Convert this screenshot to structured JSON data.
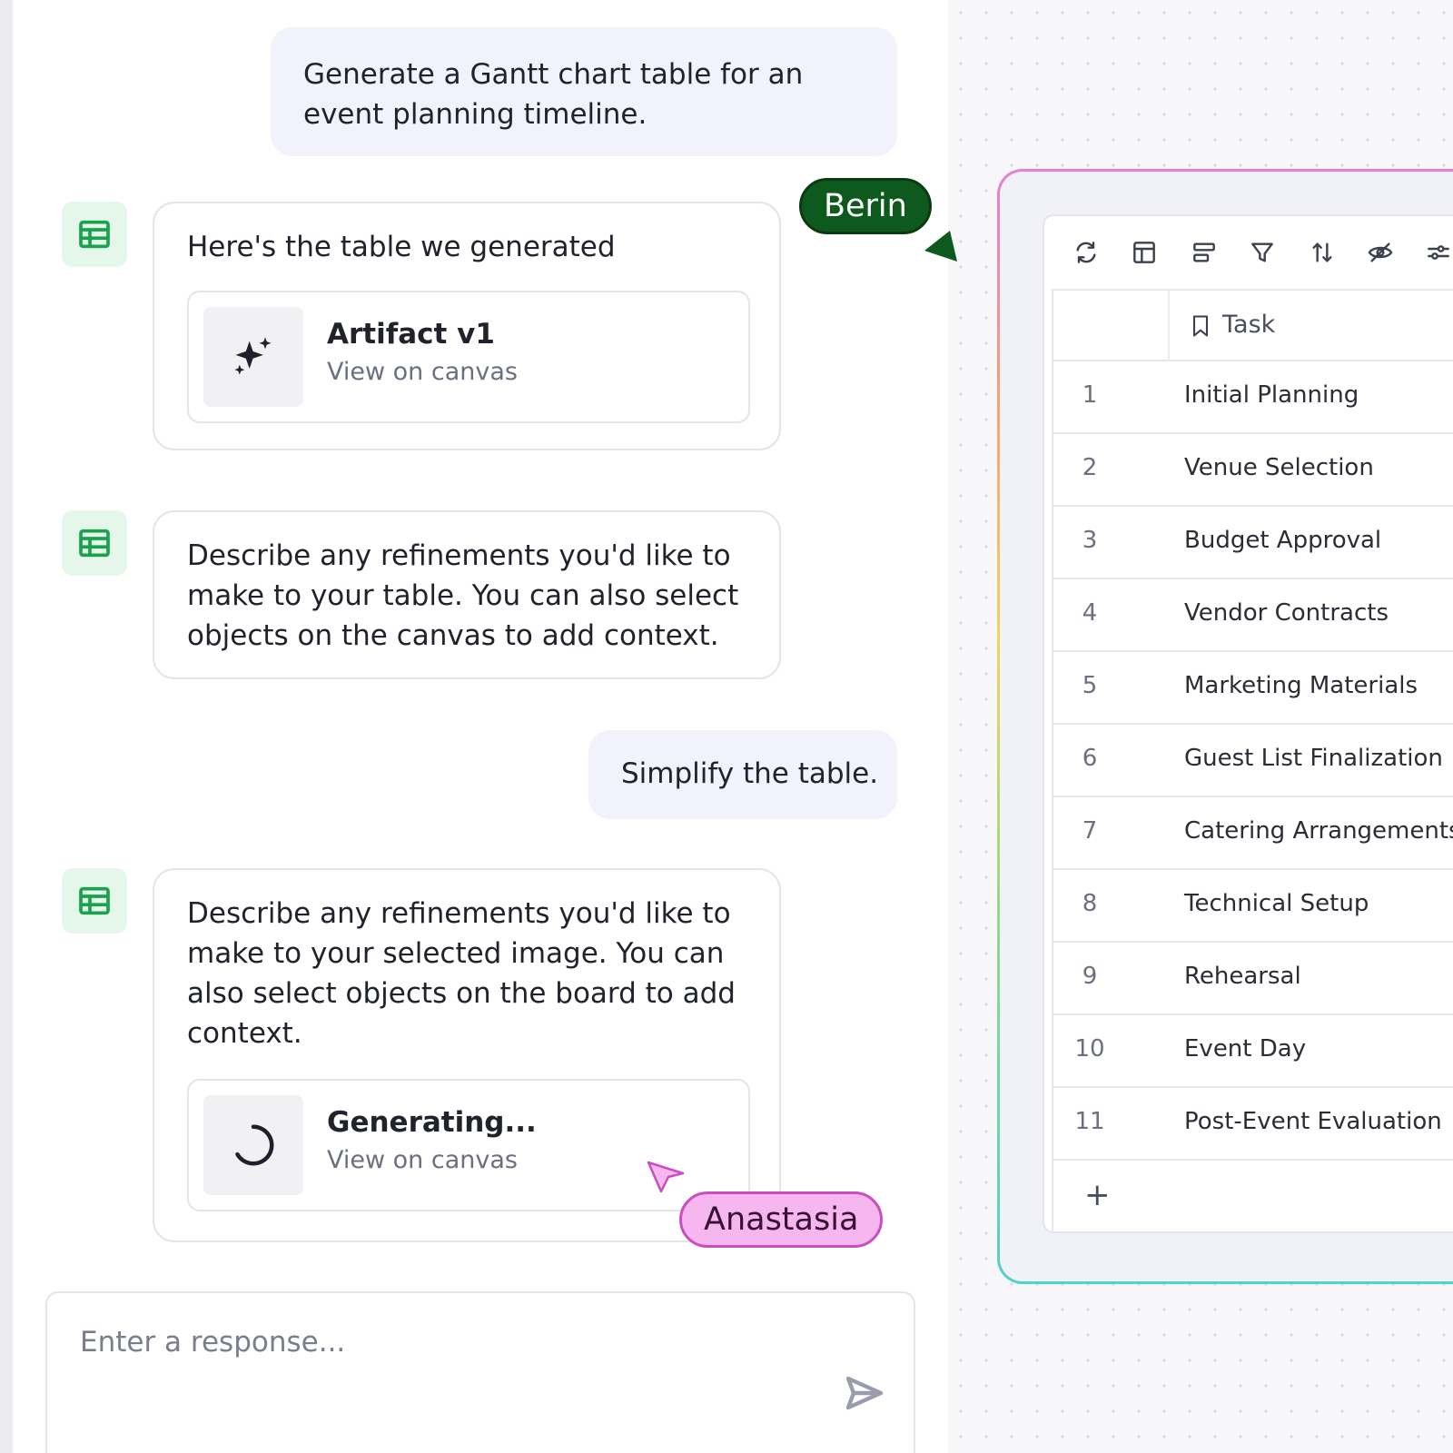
{
  "chat": {
    "messages": [
      {
        "role": "user",
        "text": "Generate a Gantt chart table for an event planning timeline."
      },
      {
        "role": "assistant",
        "text": "Here's the table we generated",
        "artifact": {
          "title": "Artifact v1",
          "link": "View on canvas",
          "icon": "sparkle-icon"
        }
      },
      {
        "role": "assistant",
        "text": "Describe any refinements you'd like to make to your table. You can also select objects on the canvas to add context."
      },
      {
        "role": "user",
        "text": "Simplify the table."
      },
      {
        "role": "assistant",
        "text": "Describe any refinements you'd like to make to your selected image. You can also select objects on the board to add context.",
        "artifact": {
          "title": "Generating...",
          "link": "View on canvas",
          "icon": "spinner-icon"
        }
      }
    ],
    "input": {
      "placeholder": "Enter a response..."
    }
  },
  "table": {
    "toolbar_icons": [
      "refresh-icon",
      "layout-icon",
      "align-icon",
      "filter-icon",
      "sort-icon",
      "hide-icon",
      "settings-icon"
    ],
    "column_header": "Task",
    "rows": [
      {
        "num": "1",
        "task": "Initial Planning"
      },
      {
        "num": "2",
        "task": "Venue Selection"
      },
      {
        "num": "3",
        "task": "Budget Approval"
      },
      {
        "num": "4",
        "task": "Vendor Contracts"
      },
      {
        "num": "5",
        "task": "Marketing Materials"
      },
      {
        "num": "6",
        "task": "Guest List Finalization"
      },
      {
        "num": "7",
        "task": "Catering Arrangements"
      },
      {
        "num": "8",
        "task": "Technical Setup"
      },
      {
        "num": "9",
        "task": "Rehearsal"
      },
      {
        "num": "10",
        "task": "Event Day"
      },
      {
        "num": "11",
        "task": "Post-Event Evaluation"
      }
    ],
    "add_row_label": "+"
  },
  "collaborators": [
    {
      "name": "Berin",
      "color": "#0e5a1e"
    },
    {
      "name": "Anastasia",
      "color": "#f6b6f0"
    }
  ],
  "colors": {
    "accent_green": "#16a34a",
    "user_bubble": "#f1f2fb"
  }
}
